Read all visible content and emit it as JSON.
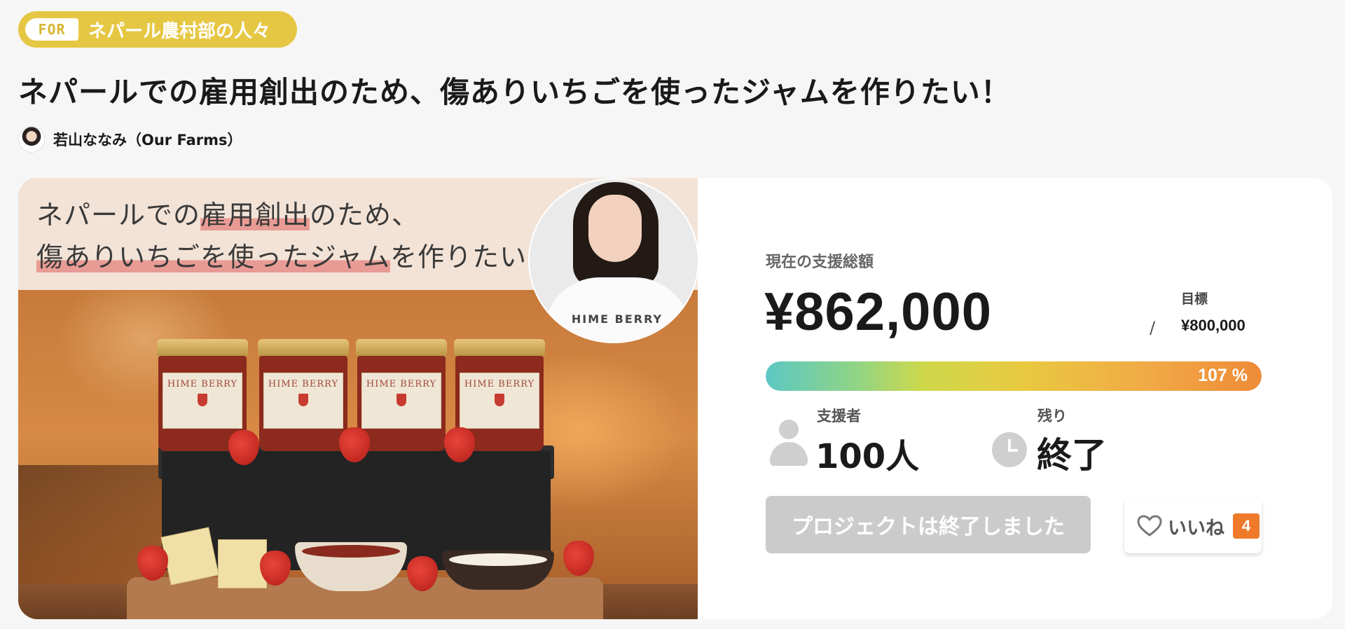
{
  "badge": {
    "tag": "FOR",
    "text": "ネパール農村部の人々"
  },
  "project": {
    "title": "ネパールでの雇用創出のため、傷ありいちごを使ったジャムを作りたい！",
    "author": "若山ななみ（Our Farms）"
  },
  "hero": {
    "line1_a": "ネパールでの",
    "line1_hl": "雇用創出",
    "line1_b": "のため、",
    "line2_hl": "傷ありいちごを使ったジャム",
    "line2_b": "を作りたい！",
    "shirt_logo": "HIME BERRY",
    "jars": [
      {
        "brand": "HIME BERRY"
      },
      {
        "brand": "HIME BERRY"
      },
      {
        "brand": "HIME BERRY"
      },
      {
        "brand": "HIME BERRY"
      }
    ]
  },
  "stats": {
    "total_label": "現在の支援総額",
    "total_amount": "¥862,000",
    "goal_separator": "/",
    "goal_label": "目標",
    "goal_amount": "¥800,000",
    "progress_label": "107 %",
    "progress_fraction": 1.07,
    "backers_label": "支援者",
    "backers_value": "100人",
    "remaining_label": "残り",
    "remaining_value": "終了"
  },
  "actions": {
    "ended_label": "プロジェクトは終了しました",
    "like_label": "いいね",
    "like_count": "4"
  },
  "icons": {
    "person": "person-icon",
    "clock": "clock-icon",
    "heart": "heart-outline-icon"
  },
  "colors": {
    "badge": "#e6c744",
    "accent_orange": "#ee7a2a",
    "disabled_button": "#cbcbcb"
  }
}
